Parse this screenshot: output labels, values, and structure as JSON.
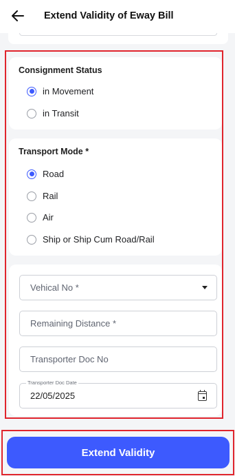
{
  "header": {
    "back_icon": "arrow-left-icon",
    "title": "Extend Validity of Eway Bill"
  },
  "consignment": {
    "title": "Consignment Status",
    "options": [
      {
        "label": "in Movement",
        "selected": true
      },
      {
        "label": "in Transit",
        "selected": false
      }
    ]
  },
  "transport": {
    "title": "Transport Mode *",
    "options": [
      {
        "label": "Road",
        "selected": true
      },
      {
        "label": "Rail",
        "selected": false
      },
      {
        "label": "Air",
        "selected": false
      },
      {
        "label": "Ship or Ship Cum Road/Rail",
        "selected": false
      }
    ]
  },
  "form": {
    "vehicle_placeholder": "Vehical No *",
    "distance_placeholder": "Remaining Distance *",
    "doc_no_placeholder": "Transporter Doc No",
    "doc_date_label": "Transporter Doc Date",
    "doc_date_value": "22/05/2025",
    "calendar_icon": "calendar-icon"
  },
  "footer": {
    "button_label": "Extend Validity"
  },
  "colors": {
    "accent": "#3d5afe",
    "highlight": "#e0242c"
  }
}
